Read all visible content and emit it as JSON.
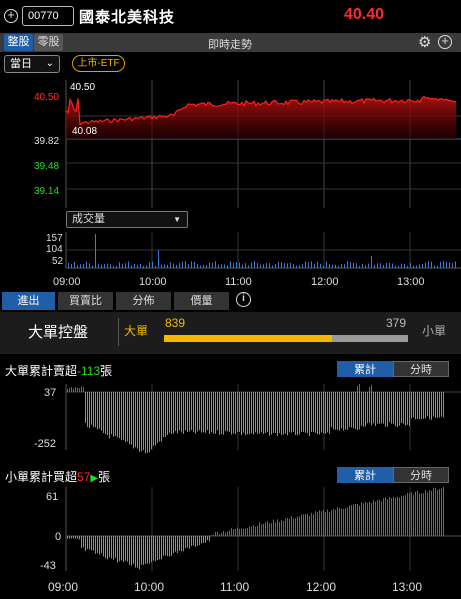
{
  "header": {
    "stock_code": "00770",
    "stock_name": "國泰北美科技",
    "price": "40.40"
  },
  "tabs": {
    "lot_whole": "整股",
    "lot_odd": "零股",
    "title": "即時走勢"
  },
  "range_select": {
    "value": "當日"
  },
  "badge": "上市-ETF",
  "price_chart": {
    "y_labels": [
      {
        "text": "40.50",
        "color": "#ff3030"
      },
      {
        "text": "39.82",
        "color": "#e0e0e0"
      },
      {
        "text": "39.48",
        "color": "#22dd22"
      },
      {
        "text": "39.14",
        "color": "#22dd22"
      }
    ],
    "high_label": "40.50",
    "low_label": "40.08"
  },
  "volume_select": {
    "value": "成交量"
  },
  "volume_chart": {
    "y_labels": [
      "157",
      "104",
      "52"
    ]
  },
  "time_labels": [
    "09:00",
    "10:00",
    "11:00",
    "12:00",
    "13:00"
  ],
  "sub_tabs": [
    {
      "label": "進出",
      "active": true
    },
    {
      "label": "買賣比",
      "active": false
    },
    {
      "label": "分佈",
      "active": false
    },
    {
      "label": "價量",
      "active": false
    }
  ],
  "control": {
    "title": "大單控盤",
    "big_label": "大單",
    "small_label": "小單",
    "big_value": "839",
    "small_value": "379",
    "big_fraction": 0.689
  },
  "big_order": {
    "title_prefix": "大單累計賣超",
    "title_value": "-113",
    "title_suffix": "張",
    "seg_cum": "累計",
    "seg_time": "分時",
    "y_top": "37",
    "y_bottom": "-252"
  },
  "small_order": {
    "title_prefix": "小單累計買超",
    "title_value": "57",
    "title_suffix": "張",
    "seg_cum": "累計",
    "seg_time": "分時",
    "y_top": "61",
    "y_mid": "0",
    "y_bottom": "-43"
  },
  "colors": {
    "up": "#ff2a2a",
    "down": "#22dd22",
    "accent": "#1f5fa8",
    "highlight": "#f5b800"
  }
}
